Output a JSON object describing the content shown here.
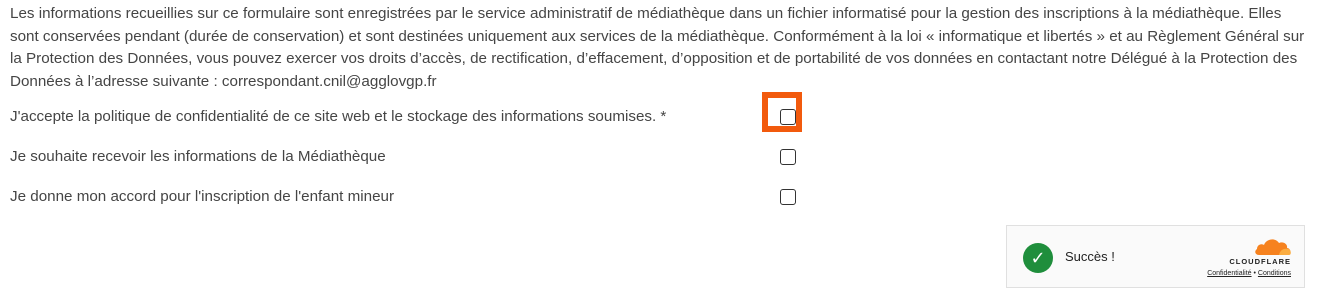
{
  "notice": {
    "text": "Les informations recueillies sur ce formulaire sont enregistrées par le service administratif de médiathèque dans un fichier informatisé pour la gestion des inscriptions à la médiathèque. Elles sont conservées pendant (durée de conservation) et sont destinées uniquement aux services de la médiathèque. Conformément à la loi « informatique et libertés » et au Règlement Général sur la Protection des Données, vous pouvez exercer vos droits d’accès, de rectification, d’effacement, d’opposition et de portabilité de vos données en contactant notre Délégué à la Protection des Données à l’adresse suivante : correspondant.cnil@agglovgp.fr"
  },
  "consents": [
    {
      "label": "J'accepte la politique de confidentialité de ce site web et le stockage des informations soumises. *",
      "checked": false,
      "highlighted": true
    },
    {
      "label": "Je souhaite recevoir les informations de la Médiathèque",
      "checked": false
    },
    {
      "label": "Je donne mon accord pour l'inscription de l'enfant mineur",
      "checked": false
    }
  ],
  "turnstile": {
    "status_text": "Succès !",
    "brand": "CLOUDFLARE",
    "privacy_link": "Confidentialité",
    "separator": "•",
    "terms_link": "Conditions",
    "icon": "check-circle-icon"
  },
  "colors": {
    "highlight": "#f25a0d",
    "success": "#1f8e3c",
    "cloudflare_orange": "#f6821f",
    "text": "#454545"
  }
}
